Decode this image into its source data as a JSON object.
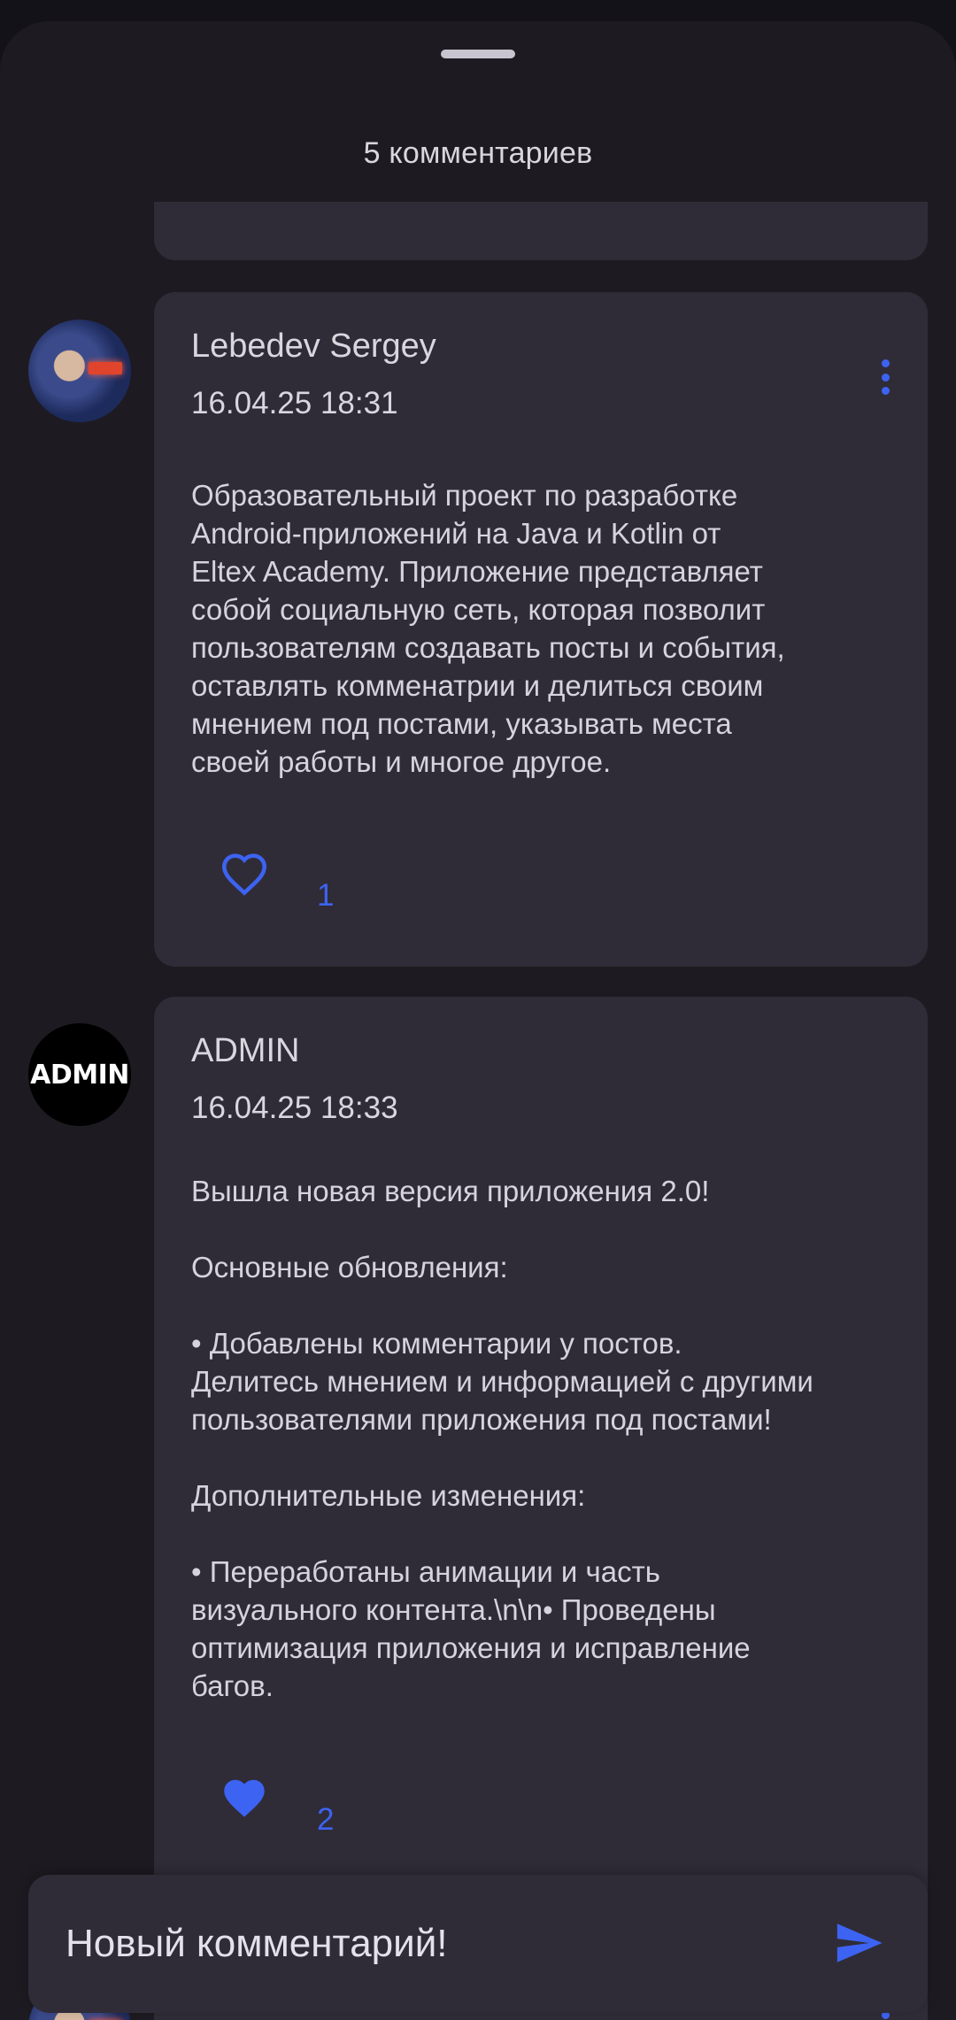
{
  "sheet": {
    "title": "5 комментариев"
  },
  "comments": [
    {
      "author": "Lebedev Sergey",
      "date": "16.04.25 18:31",
      "text": "Образовательный проект по разработке\nAndroid-приложений на Java и Kotlin от\nEltex Academy. Приложение представляет\nсобой социальную сеть, которая позволит\nпользователям создавать посты и события,\nоставлять комменатрии и делиться своим\nмнением под постами, указывать места\nсвоей работы и многое другое.",
      "likes": "1",
      "liked": false,
      "avatar_icon": "user-photo-avatar"
    },
    {
      "author": "ADMIN",
      "date": "16.04.25 18:33",
      "avatar_text": "ADMIN",
      "text": "Вышла новая версия приложения 2.0!\n\nОсновные обновления:\n\n• Добавлены комментарии у постов.\nДелитесь мнением и информацией с другими\nпользователями приложения под постами!\n\nДополнительные изменения:\n\n• Переработаны анимации и часть\nвизуального контента.\\n\\n• Проведены\nоптимизация приложения и исправление\nбагов.",
      "likes": "2",
      "liked": true
    }
  ],
  "input": {
    "value": "Новый комментарий!",
    "send_icon": "send-icon"
  },
  "colors": {
    "accent": "#3d63f2",
    "card": "#2f2c38",
    "sheet": "#1d1b21"
  }
}
